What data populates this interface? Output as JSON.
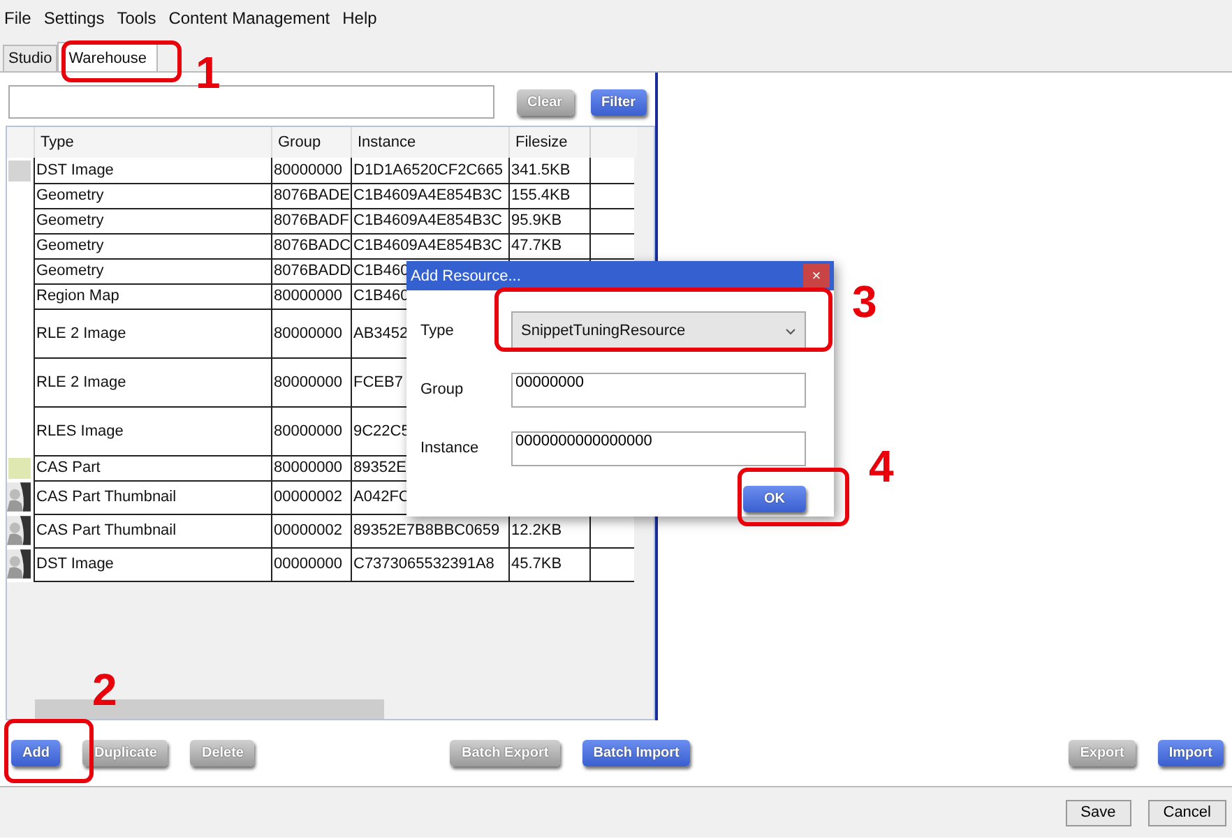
{
  "menu": [
    "File",
    "Settings",
    "Tools",
    "Content Management",
    "Help"
  ],
  "tabs": [
    {
      "label": "Studio",
      "selected": false
    },
    {
      "label": "Warehouse",
      "selected": true
    }
  ],
  "filter_bar": {
    "buttons": [
      {
        "label": "Clear",
        "kind": "grey"
      },
      {
        "label": "Filter",
        "kind": "blue"
      }
    ]
  },
  "table": {
    "columns": [
      "Type",
      "Group",
      "Instance",
      "Filesize"
    ],
    "rows": [
      {
        "thumb": {
          "kind": "swatch",
          "color": "#d4d4d4"
        },
        "cells": [
          "DST Image",
          "80000000",
          "D1D1A6520CF2C665",
          "341.5KB"
        ],
        "kind": "short"
      },
      {
        "cells": [
          "Geometry",
          "8076BADE",
          "C1B4609A4E854B3C",
          "155.4KB"
        ],
        "kind": "short"
      },
      {
        "cells": [
          "Geometry",
          "8076BADF",
          "C1B4609A4E854B3C",
          "95.9KB"
        ],
        "kind": "short"
      },
      {
        "cells": [
          "Geometry",
          "8076BADC",
          "C1B4609A4E854B3C",
          "47.7KB"
        ],
        "kind": "short"
      },
      {
        "cells": [
          "Geometry",
          "8076BADD",
          "C1B460"
        ],
        "kind": "short"
      },
      {
        "cells": [
          "Region Map",
          "80000000",
          "C1B460"
        ],
        "kind": "short"
      },
      {
        "cells": [
          "RLE 2 Image",
          "80000000",
          "AB3452"
        ],
        "kind": "tall"
      },
      {
        "cells": [
          "RLE 2 Image",
          "80000000",
          "FCEB7"
        ],
        "kind": "tall"
      },
      {
        "cells": [
          "RLES Image",
          "80000000",
          "9C22C5"
        ],
        "kind": "tall"
      },
      {
        "thumb": {
          "kind": "swatch",
          "color": "#dfe8b0"
        },
        "cells": [
          "CAS Part",
          "80000000",
          "89352E"
        ],
        "kind": "short"
      },
      {
        "thumb": {
          "kind": "thumbnail"
        },
        "cells": [
          "CAS Part Thumbnail",
          "00000002",
          "A042FC"
        ],
        "kind": "mid"
      },
      {
        "thumb": {
          "kind": "thumbnail"
        },
        "cells": [
          "CAS Part Thumbnail",
          "00000002",
          "89352E7B8BBC0659",
          "12.2KB"
        ],
        "kind": "mid"
      },
      {
        "thumb": {
          "kind": "thumbnail"
        },
        "cells": [
          "DST Image",
          "00000000",
          "C7373065532391A8",
          "45.7KB"
        ],
        "kind": "mid"
      }
    ]
  },
  "left_buttons": [
    {
      "label": "Add",
      "kind": "blue"
    },
    {
      "label": "Duplicate",
      "kind": "grey"
    },
    {
      "label": "Delete",
      "kind": "grey"
    },
    {
      "label": "Batch Export",
      "kind": "grey"
    },
    {
      "label": "Batch Import",
      "kind": "blue"
    }
  ],
  "right_buttons": [
    {
      "label": "Export",
      "kind": "grey"
    },
    {
      "label": "Import",
      "kind": "blue"
    }
  ],
  "footer_buttons": [
    "Save",
    "Cancel"
  ],
  "dialog": {
    "title": "Add Resource...",
    "close": "×",
    "fields": [
      {
        "label": "Type",
        "kind": "dropdown",
        "value": "SnippetTuningResource"
      },
      {
        "label": "Group",
        "kind": "text",
        "value": "00000000"
      },
      {
        "label": "Instance",
        "kind": "text",
        "value": "0000000000000000"
      }
    ],
    "button": "OK"
  },
  "annotations": [
    {
      "label": "1"
    },
    {
      "label": "2"
    },
    {
      "label": "3"
    },
    {
      "label": "4"
    }
  ]
}
